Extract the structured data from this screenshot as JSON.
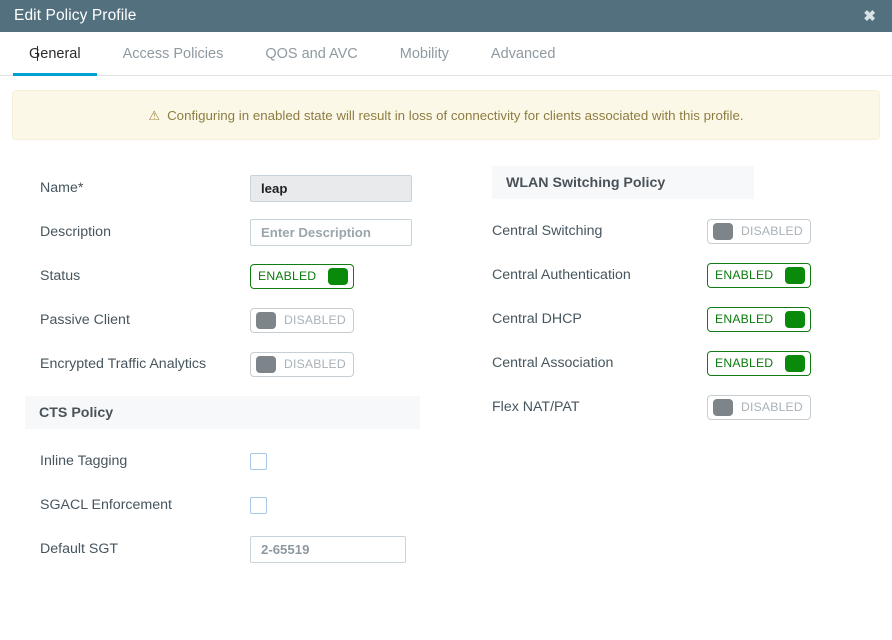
{
  "window": {
    "title": "Edit Policy Profile",
    "close_icon": "close-icon",
    "close_glyph": "✖"
  },
  "tabs": [
    {
      "label": "General",
      "active": true
    },
    {
      "label": "Access Policies",
      "active": false
    },
    {
      "label": "QOS and AVC",
      "active": false
    },
    {
      "label": "Mobility",
      "active": false
    },
    {
      "label": "Advanced",
      "active": false
    }
  ],
  "banner": {
    "icon": "warning-triangle-icon",
    "icon_glyph": "⚠",
    "text": "Configuring in enabled state will result in loss of connectivity for clients associated with this profile.",
    "background": "#fcf8e8",
    "text_color": "#8d7c42"
  },
  "left_column": {
    "fields": [
      {
        "label": "Name*",
        "type": "text",
        "value": "leap",
        "placeholder": ""
      },
      {
        "label": "Description",
        "type": "text",
        "value": "",
        "placeholder": "Enter Description"
      },
      {
        "label": "Status",
        "type": "toggle",
        "state": "ENABLED"
      },
      {
        "label": "Passive Client",
        "type": "toggle",
        "state": "DISABLED"
      },
      {
        "label": "Encrypted Traffic Analytics",
        "type": "toggle",
        "state": "DISABLED"
      }
    ],
    "cts_section": {
      "title": "CTS Policy",
      "fields": [
        {
          "label": "Inline Tagging",
          "type": "checkbox",
          "checked": false
        },
        {
          "label": "SGACL Enforcement",
          "type": "checkbox",
          "checked": false
        },
        {
          "label": "Default SGT",
          "type": "text",
          "value": "",
          "placeholder": "2-65519"
        }
      ]
    }
  },
  "right_column": {
    "wlan_section": {
      "title": "WLAN Switching Policy",
      "fields": [
        {
          "label": "Central Switching",
          "type": "toggle",
          "state": "DISABLED"
        },
        {
          "label": "Central Authentication",
          "type": "toggle",
          "state": "ENABLED"
        },
        {
          "label": "Central DHCP",
          "type": "toggle",
          "state": "ENABLED"
        },
        {
          "label": "Central Association",
          "type": "toggle",
          "state": "ENABLED"
        },
        {
          "label": "Flex NAT/PAT",
          "type": "toggle",
          "state": "DISABLED"
        }
      ]
    }
  },
  "colors": {
    "titlebar": "#53707f",
    "accent_tab": "#00a0d1",
    "toggle_on": "#0a8a0a",
    "toggle_off": "#7d858a"
  }
}
